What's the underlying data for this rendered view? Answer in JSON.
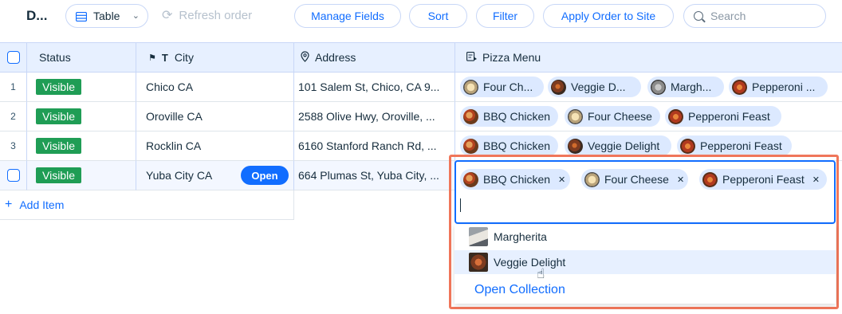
{
  "toolbar": {
    "title": "D...",
    "view_label": "Table",
    "refresh_label": "Refresh order",
    "manage_fields": "Manage Fields",
    "sort": "Sort",
    "filter": "Filter",
    "apply_order": "Apply Order to Site",
    "search_placeholder": "Search"
  },
  "columns": {
    "status": "Status",
    "city": "City",
    "address": "Address",
    "pizza_menu": "Pizza Menu"
  },
  "rows": [
    {
      "num": "1",
      "status": "Visible",
      "city": "Chico CA",
      "address": "101 Salem St, Chico, CA 9...",
      "pizzas": [
        "Four Ch...",
        "Veggie D...",
        "Margh...",
        "Pepperoni ..."
      ]
    },
    {
      "num": "2",
      "status": "Visible",
      "city": "Oroville CA",
      "address": "2588 Olive Hwy, Oroville, ...",
      "pizzas": [
        "BBQ Chicken",
        "Four Cheese",
        "Pepperoni Feast"
      ]
    },
    {
      "num": "3",
      "status": "Visible",
      "city": "Rocklin CA",
      "address": "6160 Stanford Ranch Rd, ...",
      "pizzas": [
        "BBQ Chicken",
        "Veggie Delight",
        "Pepperoni Feast"
      ]
    },
    {
      "num": "",
      "status": "Visible",
      "city": "Yuba City CA",
      "address": "664 Plumas St, Yuba City, ...",
      "open_label": "Open"
    }
  ],
  "add_item": "Add Item",
  "editor": {
    "selected": [
      "BBQ Chicken",
      "Four Cheese",
      "Pepperoni Feast"
    ],
    "options": [
      "Margherita",
      "Veggie Delight"
    ],
    "open_collection": "Open Collection"
  },
  "colors": {
    "accent": "#116dff",
    "header_bg": "#e7f0ff",
    "visible_badge": "#1f9d55",
    "highlight_border": "#f0765a"
  }
}
